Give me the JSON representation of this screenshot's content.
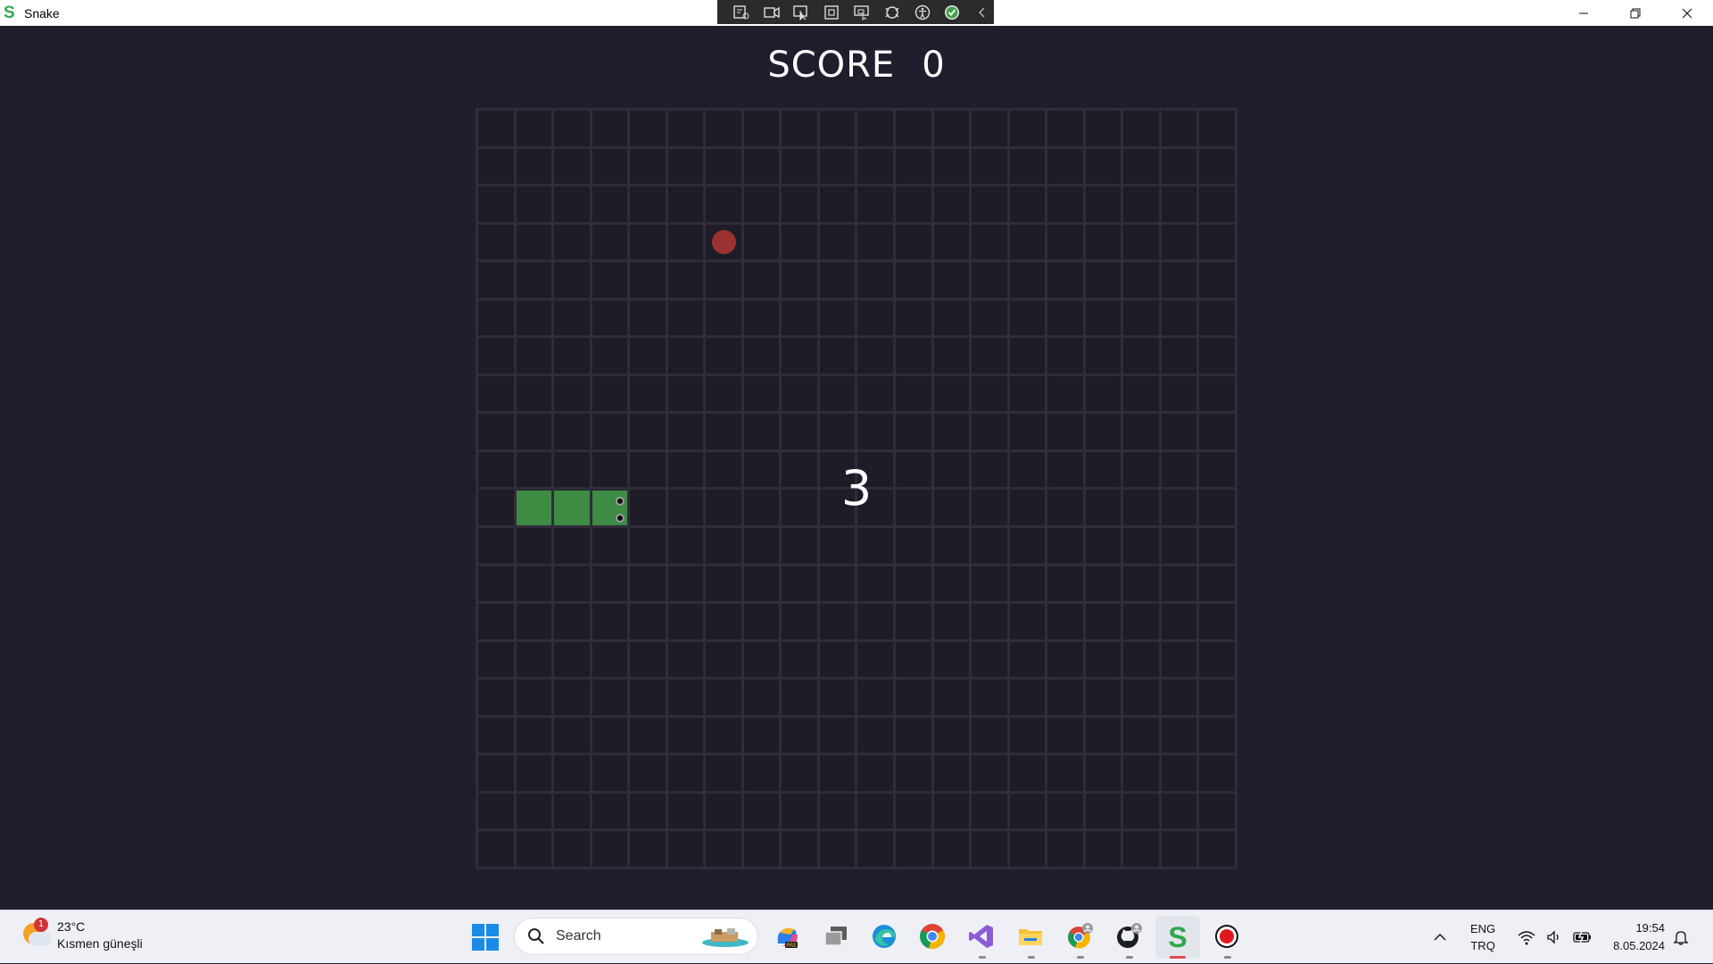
{
  "window": {
    "title": "Snake",
    "app_icon_letter": "S",
    "debug_toolbar_icons": [
      "live-visual-tree-icon",
      "record-icon",
      "select-element-icon",
      "display-layout-adorners-icon",
      "track-focus-icon",
      "hot-reload-icon",
      "accessibility-icon",
      "binding-check-icon",
      "collapse-chevron-icon"
    ],
    "controls": [
      "minimize",
      "restore",
      "close"
    ]
  },
  "game": {
    "score_label": "SCORE",
    "score_value": "0",
    "countdown": "3",
    "grid_columns": 20,
    "grid_rows": 20,
    "food": {
      "col": 6,
      "row": 3,
      "color": "#9b3232"
    },
    "snake": {
      "cells": [
        {
          "col": 1,
          "row": 10
        },
        {
          "col": 2,
          "row": 10
        },
        {
          "col": 3,
          "row": 10
        }
      ],
      "head_direction": "right",
      "color": "#3e8b44"
    },
    "colors": {
      "background": "#1f1e2c",
      "cell": "#1e1c26",
      "grid_line": "#302d3a"
    }
  },
  "taskbar": {
    "weather": {
      "temperature": "23°C",
      "condition": "Kısmen güneşli",
      "badge": "1"
    },
    "search_placeholder": "Search",
    "pinned_apps": [
      "copilot-icon",
      "task-view-icon",
      "edge-icon",
      "chrome-icon",
      "visual-studio-icon",
      "file-explorer-icon",
      "chrome-profile-icon",
      "github-icon",
      "snake-app-icon",
      "screen-recorder-icon"
    ],
    "tray": {
      "language_top": "ENG",
      "language_bottom": "TRQ",
      "time": "19:54",
      "date": "8.05.2024"
    }
  }
}
